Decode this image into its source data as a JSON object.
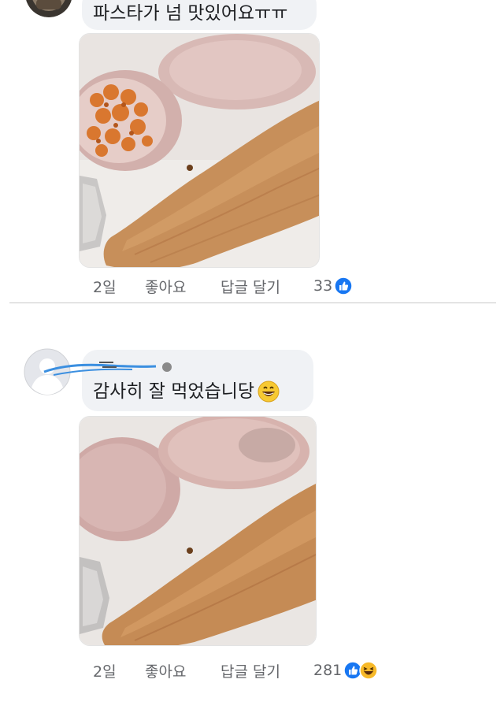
{
  "comments": [
    {
      "text": "파스타가 넘 맛있어요ㅠㅠ",
      "time": "2일",
      "like_label": "좋아요",
      "reply_label": "답글 달기",
      "reaction_count": "33",
      "reactions": [
        "like-icon"
      ]
    },
    {
      "author": "",
      "text": "감사히 잘 먹었습니당",
      "text_emoji": "grinning-emoji",
      "time": "2일",
      "like_label": "좋아요",
      "reply_label": "답글 달기",
      "reaction_count": "281",
      "reactions": [
        "like-icon",
        "haha-icon"
      ]
    }
  ],
  "colors": {
    "bubble": "#f0f2f5",
    "meta_text": "#65676b",
    "like_blue": "#1877f2",
    "haha_yellow": "#f7b928",
    "redaction_scribble": "#3b8fe0"
  }
}
